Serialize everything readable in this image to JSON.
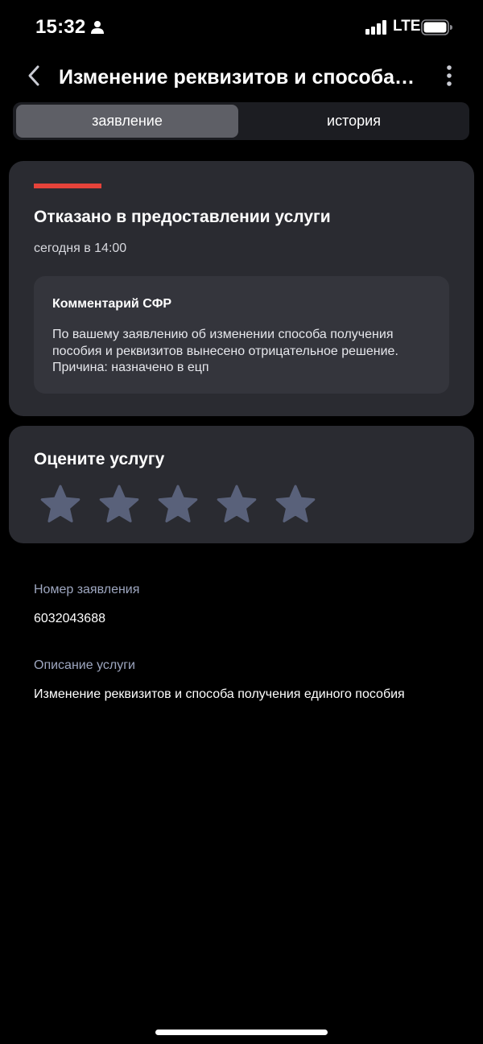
{
  "status_bar": {
    "time": "15:32",
    "network": "LTE",
    "icons": [
      "person-icon",
      "cellular-signal-icon",
      "battery-icon"
    ]
  },
  "header": {
    "title": "Изменение реквизитов и способа получения единого пособия",
    "icons": [
      "chevron-left-icon",
      "more-vertical-icon"
    ]
  },
  "tabs": [
    {
      "label": "заявление",
      "active": true
    },
    {
      "label": "история",
      "active": false
    }
  ],
  "status": {
    "title": "Отказано в предоставлении услуги",
    "time": "сегодня в 14:00",
    "accent_color": "#e5433a",
    "comment": {
      "heading": "Комментарий СФР",
      "text": "По вашему заявлению об изменении способа получения пособия и реквизитов вынесено отрицательное решение. Причина: назначено в ецп"
    }
  },
  "rating": {
    "title": "Оцените услугу",
    "max_stars": 5,
    "selected": 0,
    "star_color": "#59617a"
  },
  "details": {
    "application_number_label": "Номер заявления",
    "application_number": "6032043688",
    "service_description_label": "Описание услуги",
    "service_description": "Изменение реквизитов и способа получения единого пособия"
  },
  "colors": {
    "background": "#000000",
    "card": "#2a2b31",
    "tab_active": "#5e5f66",
    "label": "#9ea7c0"
  }
}
